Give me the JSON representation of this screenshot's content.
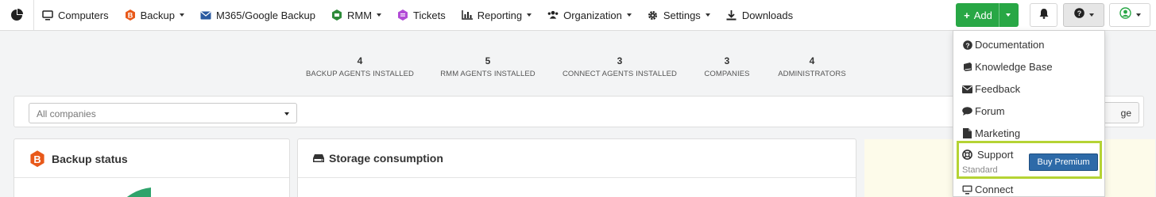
{
  "nav": {
    "items": [
      {
        "label": "Computers",
        "icon": "monitor-icon",
        "caret": false
      },
      {
        "label": "Backup",
        "icon": "backup-icon",
        "caret": true
      },
      {
        "label": "M365/Google Backup",
        "icon": "envelope-icon",
        "caret": false
      },
      {
        "label": "RMM",
        "icon": "rmm-icon",
        "caret": true
      },
      {
        "label": "Tickets",
        "icon": "tickets-icon",
        "caret": false
      },
      {
        "label": "Reporting",
        "icon": "bar-chart-icon",
        "caret": true
      },
      {
        "label": "Organization",
        "icon": "users-icon",
        "caret": true
      },
      {
        "label": "Settings",
        "icon": "gear-icon",
        "caret": true
      },
      {
        "label": "Downloads",
        "icon": "download-icon",
        "caret": false
      }
    ],
    "add_label": "Add"
  },
  "stats": [
    {
      "value": "4",
      "label": "BACKUP AGENTS INSTALLED"
    },
    {
      "value": "5",
      "label": "RMM AGENTS INSTALLED"
    },
    {
      "value": "3",
      "label": "CONNECT AGENTS INSTALLED"
    },
    {
      "value": "3",
      "label": "COMPANIES"
    },
    {
      "value": "4",
      "label": "ADMINISTRATORS"
    }
  ],
  "filter": {
    "company_select": "All companies",
    "manage_label_visible": "ge"
  },
  "widgets": {
    "backup_status": "Backup status",
    "storage_consumption": "Storage consumption"
  },
  "help_menu": {
    "items": [
      {
        "label": "Documentation",
        "icon": "question-circle-icon"
      },
      {
        "label": "Knowledge Base",
        "icon": "book-icon"
      },
      {
        "label": "Feedback",
        "icon": "envelope-icon"
      },
      {
        "label": "Forum",
        "icon": "comment-icon"
      },
      {
        "label": "Marketing",
        "icon": "file-icon"
      }
    ],
    "support": {
      "label": "Support",
      "tier": "Standard",
      "button": "Buy Premium"
    },
    "connect": "Connect"
  },
  "colors": {
    "add_button": "#28a745",
    "buy_premium": "#2d6aa8",
    "highlight": "#b5d334",
    "backup_orange": "#e8591a",
    "rmm_green": "#2e8b3a",
    "tickets_purple": "#b24bd6",
    "m365_blue": "#2a5aa0",
    "chart_green": "#2fa36b"
  }
}
